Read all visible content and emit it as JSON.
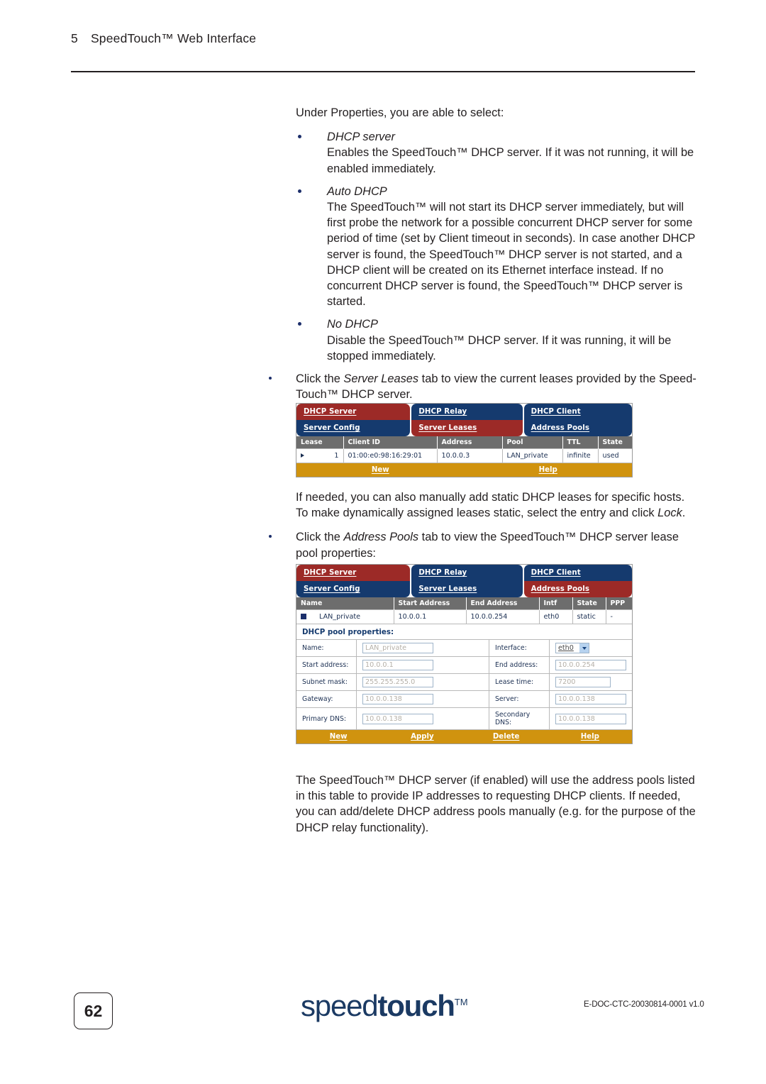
{
  "header": {
    "chapter_number": "5",
    "chapter_title": "SpeedTouch™ Web Interface"
  },
  "body": {
    "intro": "Under Properties, you are able to select:",
    "options": [
      {
        "term": "DHCP server",
        "text": "Enables the SpeedTouch™ DHCP server. If it was not running, it will be enabled immediately."
      },
      {
        "term": "Auto DHCP",
        "text": "The SpeedTouch™ will not start its DHCP server immediately, but will first probe the network for a possible concurrent DHCP server for some period of time (set by Client timeout in seconds). In case another DHCP server is found, the SpeedTouch™ DHCP server is not started, and a DHCP client will be created on its Ethernet interface instead. If no concurrent DHCP server is found, the SpeedTouch™ DHCP server is started."
      },
      {
        "term": "No DHCP",
        "text": "Disable the SpeedTouch™ DHCP server. If it was running, it will be stopped immediately."
      }
    ],
    "step_leases": {
      "pre": "Click the ",
      "em": "Server Leases",
      "post": " tab to view the current leases provided by the Speed-Touch™ DHCP server."
    },
    "note_static": {
      "pre": "If needed, you can also manually add static DHCP leases for specific hosts. To make dynamically assigned leases static, select the entry and click ",
      "em": "Lock",
      "post": "."
    },
    "step_pools": {
      "pre": "Click the ",
      "em": "Address Pools",
      "post": " tab to view the SpeedTouch™ DHCP server lease pool properties:"
    },
    "closing": "The SpeedTouch™ DHCP server (if enabled) will use the address pools listed in this table to provide IP addresses to requesting DHCP clients. If needed, you can add/delete DHCP address pools manually (e.g. for the purpose of the DHCP relay functionality)."
  },
  "colors": {
    "tab_active_red": "#9c2a27",
    "tab_inactive_blue": "#153a6e",
    "grid_header_gray": "#6d6d6d",
    "action_bar_gold": "#d0930f",
    "logo_navy": "#1b3a63"
  },
  "server_leases_ui": {
    "tabs_row1": [
      {
        "label": "DHCP Server",
        "state": "active"
      },
      {
        "label": "DHCP Relay",
        "state": "inactive"
      },
      {
        "label": "DHCP Client",
        "state": "inactive"
      }
    ],
    "tabs_row2": [
      {
        "label": "Server Config",
        "state": "inactive"
      },
      {
        "label": "Server Leases",
        "state": "active"
      },
      {
        "label": "Address Pools",
        "state": "inactive"
      }
    ],
    "columns": [
      "Lease",
      "Client ID",
      "Address",
      "Pool",
      "TTL",
      "State"
    ],
    "rows": [
      {
        "lease": "1",
        "client_id": "01:00:e0:98:16:29:01",
        "address": "10.0.0.3",
        "pool": "LAN_private",
        "ttl": "infinite",
        "state": "used"
      }
    ],
    "actions": [
      "New",
      "Help"
    ]
  },
  "address_pools_ui": {
    "tabs_row1": [
      {
        "label": "DHCP Server",
        "state": "active"
      },
      {
        "label": "DHCP Relay",
        "state": "inactive"
      },
      {
        "label": "DHCP Client",
        "state": "inactive"
      }
    ],
    "tabs_row2": [
      {
        "label": "Server Config",
        "state": "inactive"
      },
      {
        "label": "Server Leases",
        "state": "inactive"
      },
      {
        "label": "Address Pools",
        "state": "active"
      }
    ],
    "columns": [
      "Name",
      "Start Address",
      "End Address",
      "Intf",
      "State",
      "PPP"
    ],
    "rows": [
      {
        "name": "LAN_private",
        "start_address": "10.0.0.1",
        "end_address": "10.0.0.254",
        "intf": "eth0",
        "state": "static",
        "ppp": "-"
      }
    ],
    "properties_title": "DHCP pool properties:",
    "fields": {
      "name_label": "Name:",
      "name_value": "LAN_private",
      "interface_label": "Interface:",
      "interface_value": "eth0",
      "start_label": "Start address:",
      "start_value": "10.0.0.1",
      "end_label": "End address:",
      "end_value": "10.0.0.254",
      "subnet_label": "Subnet mask:",
      "subnet_value": "255.255.255.0",
      "lease_label": "Lease time:",
      "lease_value": "7200",
      "gateway_label": "Gateway:",
      "gateway_value": "10.0.0.138",
      "server_label": "Server:",
      "server_value": "10.0.0.138",
      "primary_dns_label": "Primary DNS:",
      "primary_dns_value": "10.0.0.138",
      "secondary_dns_label": "Secondary DNS:",
      "secondary_dns_value": "10.0.0.138"
    },
    "actions": [
      "New",
      "Apply",
      "Delete",
      "Help"
    ]
  },
  "footer": {
    "page_number": "62",
    "logo_light": "speed",
    "logo_bold": "touch",
    "logo_tm": "TM",
    "doc_code": "E-DOC-CTC-20030814-0001 v1.0"
  }
}
